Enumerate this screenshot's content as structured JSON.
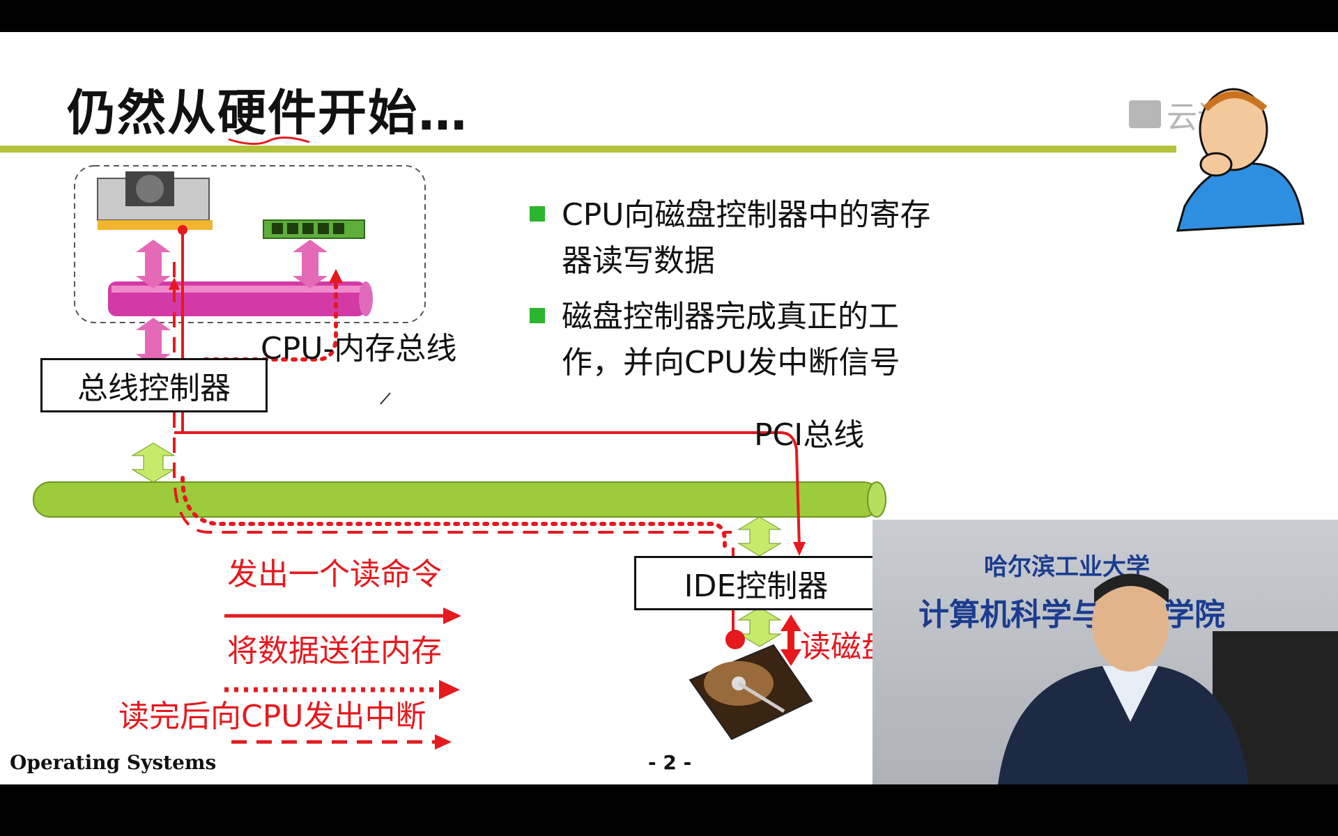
{
  "slide": {
    "title": "仍然从硬件开始…",
    "watermark": "云课堂",
    "bullets": [
      "CPU向磁盘控制器中的寄存器读写数据",
      "磁盘控制器完成真正的工作，并向CPU发中断信号"
    ],
    "labels": {
      "cpu_mem_bus": "CPU-内存总线",
      "bus_controller": "总线控制器",
      "pci_bus": "PCI总线",
      "ide_controller": "IDE控制器",
      "read_disk": "读磁盘"
    },
    "legend": [
      {
        "text": "发出一个读命令",
        "style": "solid"
      },
      {
        "text": "将数据送往内存",
        "style": "dotted"
      },
      {
        "text": "读完后向CPU发出中断",
        "style": "dashed"
      }
    ],
    "footer_left": "Operating Systems",
    "page_number": "- 2 -"
  },
  "video_overlay": {
    "banner_line1": "哈尔滨工业大学",
    "banner_line2": "计算机科学与技术学院"
  },
  "colors": {
    "accent_line": "#b4c33c",
    "arrow_red": "#e5191e",
    "bullet_green": "#2db52d",
    "membus_pink": "#d43aa6",
    "pcibus_green": "#9ccc3c"
  }
}
